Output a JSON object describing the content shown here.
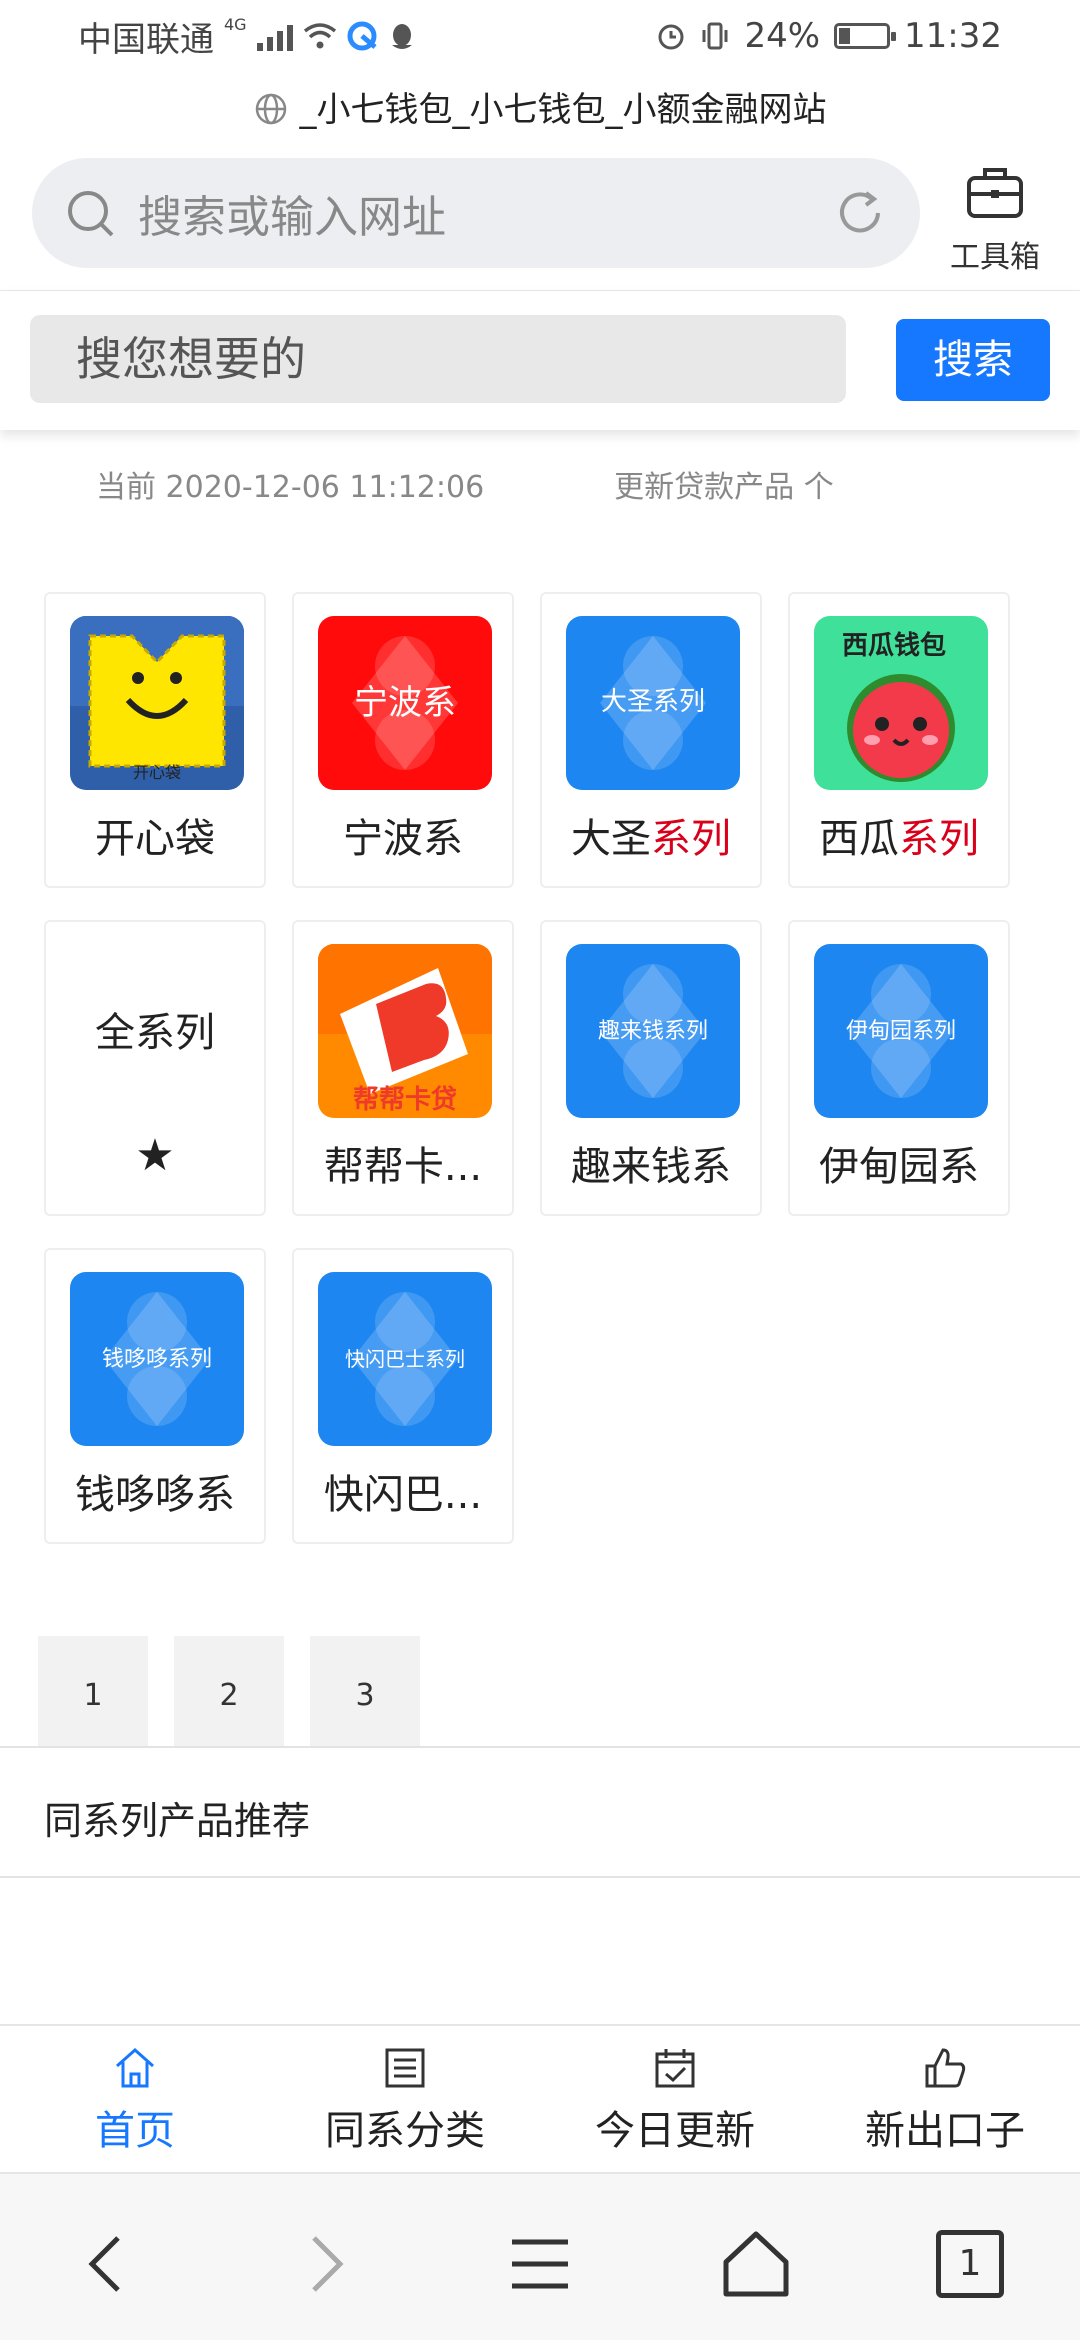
{
  "status_bar": {
    "carrier": "中国联通",
    "network": "4G",
    "battery": "24%",
    "battery_level": 0.24,
    "time": "11:32"
  },
  "page_title": "_小七钱包_小七钱包_小额金融网站",
  "url_bar": {
    "placeholder": "搜索或输入网址",
    "toolbox_label": "工具箱"
  },
  "site_search": {
    "placeholder": "搜您想要的",
    "button": "搜索"
  },
  "info": {
    "current": "当前 2020-12-06 11:12:06",
    "updated": "更新贷款产品 个"
  },
  "products": [
    {
      "name": "开心袋",
      "suffix": "",
      "icon": "happy-pocket-icon",
      "icon_text": "开心袋",
      "color": "#2f5fa8"
    },
    {
      "name": "宁波系",
      "suffix": "",
      "icon": "ningbo-series-icon",
      "icon_text": "宁波系",
      "color": "#ff0b0b"
    },
    {
      "name": "大圣",
      "suffix": "系列",
      "icon": "dasheng-series-icon",
      "icon_text": "大圣系列",
      "color": "#1e86f0"
    },
    {
      "name": "西瓜",
      "suffix": "系列",
      "icon": "watermelon-wallet-icon",
      "icon_text": "西瓜钱包",
      "color": "#3ee09a"
    },
    {
      "name": "全系列",
      "suffix": "",
      "icon": "star-icon",
      "icon_text": "★",
      "color": "#ffffff"
    },
    {
      "name": "帮帮卡...",
      "suffix": "",
      "icon": "bangbang-card-icon",
      "icon_text": "帮帮卡贷",
      "color": "#ff8a00"
    },
    {
      "name": "趣来钱系",
      "suffix": "",
      "icon": "qulaiqian-series-icon",
      "icon_text": "趣来钱系列",
      "color": "#1e86f0"
    },
    {
      "name": "伊甸园系",
      "suffix": "",
      "icon": "eden-series-icon",
      "icon_text": "伊甸园系列",
      "color": "#1e86f0"
    },
    {
      "name": "钱哆哆系",
      "suffix": "",
      "icon": "qianduoduo-series-icon",
      "icon_text": "钱哆哆系列",
      "color": "#1e86f0"
    },
    {
      "name": "快闪巴...",
      "suffix": "",
      "icon": "kuaishan-bus-series-icon",
      "icon_text": "快闪巴士系列",
      "color": "#1e86f0"
    }
  ],
  "pagination": [
    "1",
    "2",
    "3"
  ],
  "recommend_title": "同系列产品推荐",
  "tabbar": [
    {
      "label": "首页",
      "icon": "home-icon",
      "active": true
    },
    {
      "label": "同系分类",
      "icon": "list-icon",
      "active": false
    },
    {
      "label": "今日更新",
      "icon": "calendar-check-icon",
      "active": false
    },
    {
      "label": "新出口子",
      "icon": "thumbs-up-icon",
      "active": false
    }
  ],
  "browser_nav": {
    "tab_count": "1"
  },
  "colors": {
    "accent": "#1677ff",
    "red": "#d9001b"
  }
}
